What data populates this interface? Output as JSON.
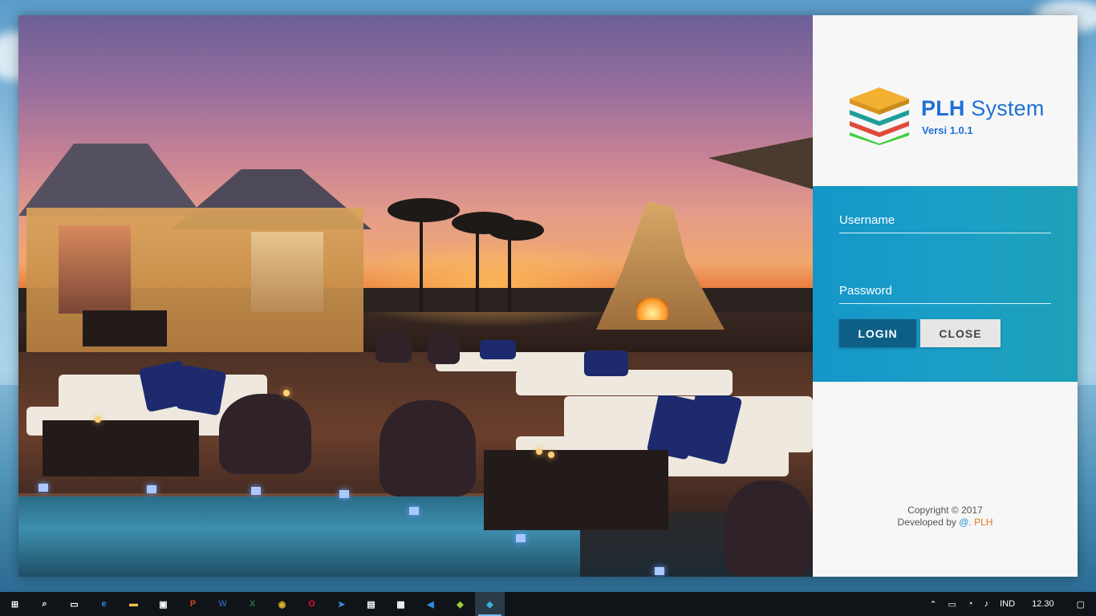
{
  "app": {
    "brand": {
      "name_bold": "PLH",
      "name_rest": " System",
      "version": "Versi 1.0.1"
    },
    "form": {
      "username_placeholder": "Username",
      "password_placeholder": "Password",
      "login_label": "LOGIN",
      "close_label": "CLOSE"
    },
    "footer": {
      "copyright": "Copyright © 2017",
      "developed_by": "Developed by ",
      "at": "@.",
      "author": " PLH"
    },
    "colors": {
      "panel_accent": "#1596c9",
      "login_button": "#0e5f86",
      "brand_blue": "#1f6fd8",
      "author_orange": "#e07a1a"
    }
  },
  "taskbar": {
    "pinned": [
      {
        "name": "start-icon",
        "glyph": "⊞",
        "color": "#ffffff"
      },
      {
        "name": "search-icon",
        "glyph": "⌕",
        "color": "#ffffff"
      },
      {
        "name": "task-view-icon",
        "glyph": "▭",
        "color": "#ffffff"
      },
      {
        "name": "edge-icon",
        "glyph": "e",
        "color": "#1e88e5"
      },
      {
        "name": "file-explorer-icon",
        "glyph": "▬",
        "color": "#f2c14e"
      },
      {
        "name": "store-icon",
        "glyph": "▣",
        "color": "#ffffff"
      },
      {
        "name": "powerpoint-icon",
        "glyph": "P",
        "color": "#d24726"
      },
      {
        "name": "word-icon",
        "glyph": "W",
        "color": "#2b579a"
      },
      {
        "name": "excel-icon",
        "glyph": "X",
        "color": "#217346"
      },
      {
        "name": "chrome-icon",
        "glyph": "◉",
        "color": "#e0b12b"
      },
      {
        "name": "opera-icon",
        "glyph": "O",
        "color": "#e0102a"
      },
      {
        "name": "app-arrow-icon",
        "glyph": "➤",
        "color": "#3c8fe6"
      },
      {
        "name": "app-window-icon",
        "glyph": "▤",
        "color": "#ffffff"
      },
      {
        "name": "calculator-icon",
        "glyph": "▦",
        "color": "#ffffff"
      },
      {
        "name": "vscode-icon",
        "glyph": "◀",
        "color": "#2a8ee6"
      },
      {
        "name": "git-icon",
        "glyph": "◆",
        "color": "#9ccc3b"
      },
      {
        "name": "plh-app-icon",
        "glyph": "◈",
        "color": "#3cb7e6",
        "active": true
      }
    ],
    "tray": {
      "language": "IND",
      "time": "12.30"
    }
  }
}
